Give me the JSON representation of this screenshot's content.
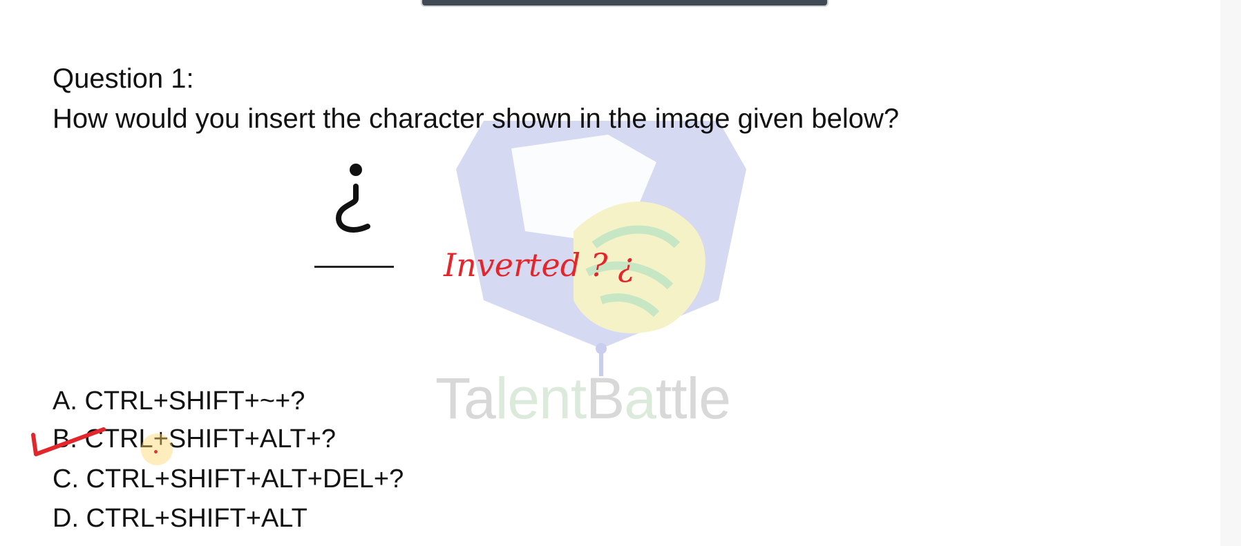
{
  "question": {
    "title": "Question 1:",
    "text": "How would you insert the character shown in the image given below?",
    "character": "¿"
  },
  "options": [
    {
      "label": "A. CTRL+SHIFT+~+?"
    },
    {
      "label": "B. CTRL+SHIFT+ALT+?"
    },
    {
      "label": "C. CTRL+SHIFT+ALT+DEL+?"
    },
    {
      "label": "D. CTRL+SHIFT+ALT"
    }
  ],
  "annotation": {
    "text": "Inverted ? ¿",
    "color": "#e3262b"
  },
  "watermark": {
    "part1": "Ta",
    "part2": "lent",
    "part3": "B",
    "part4": "a",
    "part5": "ttle"
  },
  "colors": {
    "text": "#111111",
    "annotation": "#e3262b",
    "watermark_gray": "#d8d8d8",
    "watermark_green": "#dceadc",
    "watermark_shield": "#c9cdee"
  }
}
